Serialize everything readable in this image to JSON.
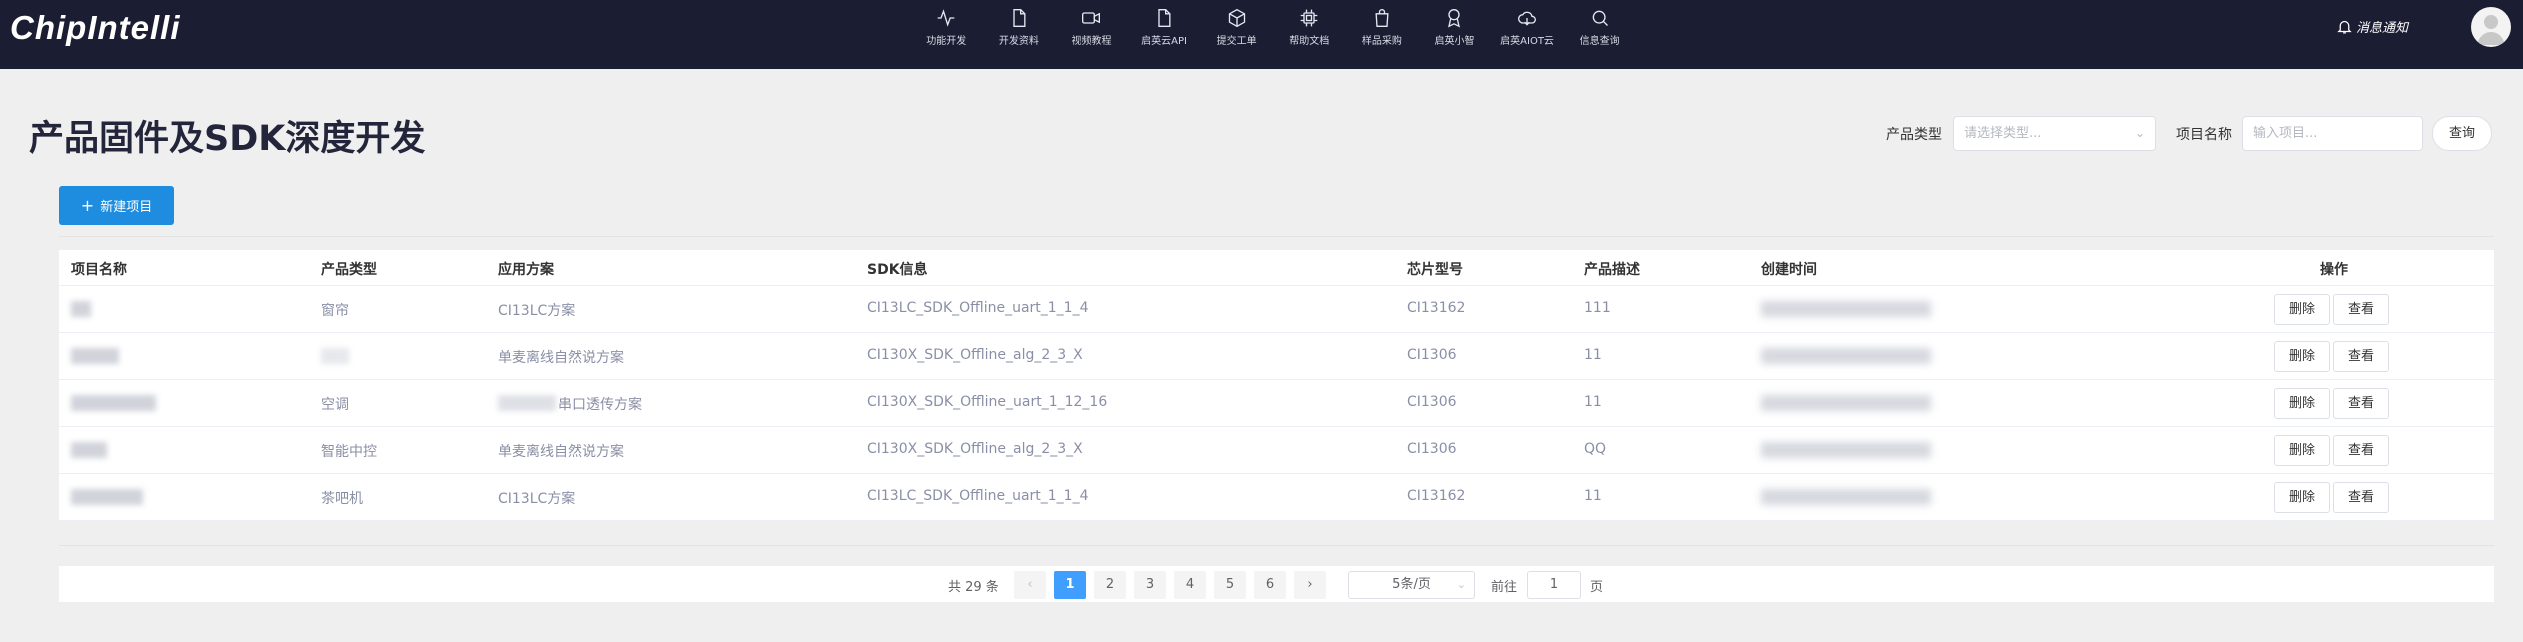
{
  "header": {
    "logo": "ChipIntelli",
    "nav": [
      {
        "label": "功能开发",
        "icon": "activity-icon"
      },
      {
        "label": "开发资料",
        "icon": "document-icon"
      },
      {
        "label": "视频教程",
        "icon": "video-icon"
      },
      {
        "label": "启英云API",
        "icon": "file-icon"
      },
      {
        "label": "提交工单",
        "icon": "box-icon"
      },
      {
        "label": "帮助文档",
        "icon": "chip-icon"
      },
      {
        "label": "样品采购",
        "icon": "shopping-bag-icon"
      },
      {
        "label": "启英小智",
        "icon": "award-icon"
      },
      {
        "label": "启英AIOT云",
        "icon": "cloud-icon"
      },
      {
        "label": "信息查询",
        "icon": "search-icon"
      }
    ],
    "notice": "消息通知"
  },
  "page": {
    "title": "产品固件及SDK深度开发"
  },
  "filters": {
    "type_label": "产品类型",
    "type_placeholder": "请选择类型...",
    "name_label": "项目名称",
    "name_placeholder": "输入项目...",
    "query_button": "查询"
  },
  "toolbar": {
    "new_button": "新建项目"
  },
  "table": {
    "headers": {
      "name": "项目名称",
      "type": "产品类型",
      "solution": "应用方案",
      "sdk": "SDK信息",
      "chip": "芯片型号",
      "desc": "产品描述",
      "created": "创建时间",
      "ops": "操作"
    },
    "rows": [
      {
        "type": "窗帘",
        "solution": "CI13LC方案",
        "sdk": "CI13LC_SDK_Offline_uart_1_1_4",
        "chip": "CI13162",
        "desc": "111"
      },
      {
        "type": "",
        "solution": "单麦离线自然说方案",
        "sdk": "CI130X_SDK_Offline_alg_2_3_X",
        "chip": "CI1306",
        "desc": "11"
      },
      {
        "type": "空调",
        "solution": "串口透传方案",
        "sdk": "CI130X_SDK_Offline_uart_1_12_16",
        "chip": "CI1306",
        "desc": "11"
      },
      {
        "type": "智能中控",
        "solution": "单麦离线自然说方案",
        "sdk": "CI130X_SDK_Offline_alg_2_3_X",
        "chip": "CI1306",
        "desc": "QQ"
      },
      {
        "type": "茶吧机",
        "solution": "CI13LC方案",
        "sdk": "CI13LC_SDK_Offline_uart_1_1_4",
        "chip": "CI13162",
        "desc": "11"
      }
    ],
    "delete_label": "删除",
    "view_label": "查看"
  },
  "pagination": {
    "total": "共 29 条",
    "prev": "‹",
    "next": "›",
    "pages": [
      "1",
      "2",
      "3",
      "4",
      "5",
      "6"
    ],
    "current": "1",
    "page_size": "5条/页",
    "goto_label": "前往",
    "goto_value": "1",
    "page_suffix": "页"
  }
}
